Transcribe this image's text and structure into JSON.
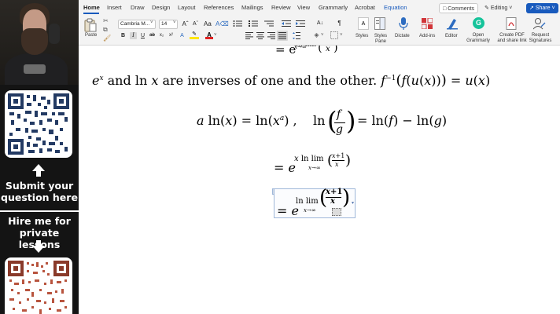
{
  "sidebar": {
    "submit_text": "Submit your question here",
    "hire_text": "Hire me for private lessons"
  },
  "ribbon": {
    "tabs": [
      "Home",
      "Insert",
      "Draw",
      "Design",
      "Layout",
      "References",
      "Mailings",
      "Review",
      "View",
      "Grammarly",
      "Acrobat",
      "Equation"
    ],
    "active_tab": "Home",
    "comments_label": "Comments",
    "editing_label": "Editing",
    "share_label": "Share",
    "paste_label": "Paste",
    "font_name": "Cambria M...",
    "font_size": "14",
    "styles_label": "Styles",
    "styles_pane_label": "Styles Pane",
    "dictate_label": "Dictate",
    "addins_label": "Add-ins",
    "editor_label": "Editor",
    "grammarly_label": "Open Grammarly",
    "pdf_label": "Create PDF and share link",
    "signatures_label": "Request Signatures"
  },
  "document": {
    "line_inverse_text": "and",
    "line_inverse_text2": "are inverses of one and the other.",
    "colors": {
      "accent": "#185abd",
      "selection_border": "#9fb7d9"
    }
  }
}
